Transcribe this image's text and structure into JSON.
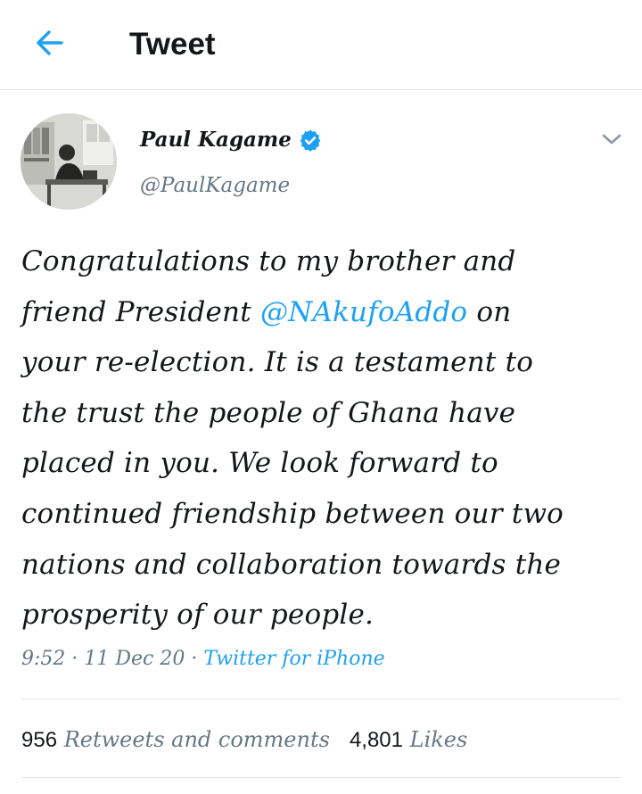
{
  "header": {
    "title": "Tweet",
    "back_icon": "arrow-left-icon"
  },
  "author": {
    "name": "Paul Kagame",
    "handle": "@PaulKagame",
    "verified_icon": "verified-badge-icon",
    "menu_icon": "chevron-down-icon"
  },
  "tweet": {
    "lines": [
      {
        "text": "Congratulations to my brother and"
      },
      {
        "pre": "friend President ",
        "mention": "@NAkufoAddo",
        "post": " on"
      },
      {
        "text": "your re-election. It is a testament to"
      },
      {
        "text": "the trust the people of Ghana have"
      },
      {
        "text": "placed in you. We look forward to"
      },
      {
        "text": "continued friendship between our two"
      },
      {
        "text": "nations and collaboration towards the"
      },
      {
        "text": "prosperity of our people."
      }
    ]
  },
  "meta": {
    "time": "9:52",
    "sep1": " · ",
    "date": "11 Dec 20",
    "sep2": " · ",
    "source": "Twitter for iPhone"
  },
  "stats": {
    "retweets_count": "956",
    "retweets_label": "Retweets and comments",
    "likes_count": "4,801",
    "likes_label": "Likes"
  },
  "colors": {
    "accent": "#1da1f2",
    "text": "#14171a",
    "muted": "#657786",
    "divider": "#e1e6ea"
  }
}
